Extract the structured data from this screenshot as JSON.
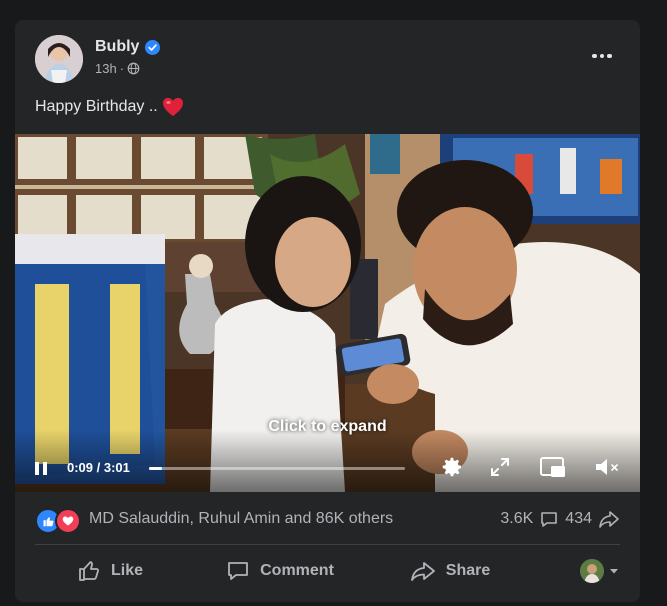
{
  "post": {
    "author": "Bubly",
    "time": "13h",
    "text": "Happy Birthday ..",
    "icons": {
      "verified": "verified-badge-icon",
      "privacy": "globe-icon",
      "more": "more-horizontal-icon",
      "emoji": "red-heart-emoji"
    }
  },
  "video": {
    "overlay_label": "Click to expand",
    "time_display": "0:09 / 3:01",
    "progress_fraction": 0.05,
    "icons": {
      "pause": "pause-icon",
      "settings": "gear-icon",
      "fullscreen": "fullscreen-icon",
      "pip": "picture-in-picture-icon",
      "volume": "volume-muted-icon"
    }
  },
  "reactions": {
    "names": "MD Salauddin, Ruhul Amin and 86K others",
    "comments_count": "3.6K",
    "shares_count": "434",
    "types": [
      "like",
      "love"
    ]
  },
  "actions": {
    "like": "Like",
    "comment": "Comment",
    "share": "Share"
  },
  "colors": {
    "background": "#18191a",
    "card": "#242526",
    "text_primary": "#e4e6eb",
    "text_secondary": "#b0b3b8",
    "like_blue": "#2d88ff",
    "love_red": "#f33e58"
  }
}
